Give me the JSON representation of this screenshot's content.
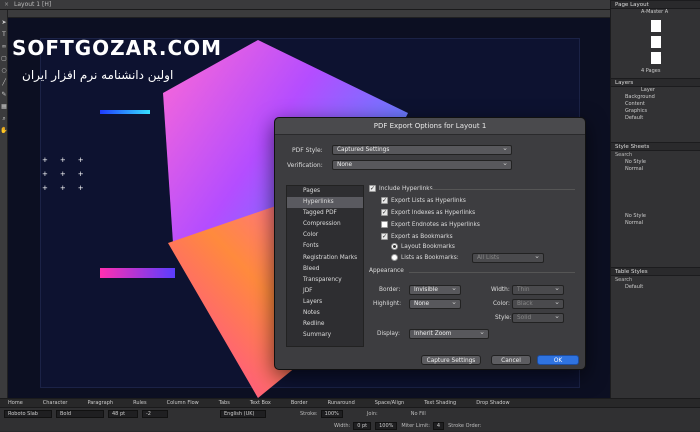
{
  "document": {
    "tab_title": "Layout 1 [H]"
  },
  "watermark": {
    "brand": "SOFTGOZAR.COM",
    "subtitle": "اولین دانشنامه نرم افزار ایران"
  },
  "right_panel": {
    "page_layout": {
      "title": "Page Layout",
      "master": "A-Master A",
      "pages_count": "4 Pages"
    },
    "layers": {
      "title": "Layers",
      "group": "Layer",
      "items": [
        "Background",
        "Content",
        "Graphics",
        "Default"
      ]
    },
    "style_sheets": {
      "title": "Style Sheets",
      "search": "Search",
      "items": [
        "No Style",
        "Normal"
      ],
      "items2": [
        "No Style",
        "Normal"
      ]
    },
    "table_styles": {
      "title": "Table Styles",
      "search": "Search",
      "item": "Default"
    }
  },
  "dialog": {
    "title": "PDF Export Options for Layout 1",
    "pdf_style_label": "PDF Style:",
    "pdf_style_value": "Captured Settings",
    "verification_label": "Verification:",
    "verification_value": "None",
    "categories": [
      "Pages",
      "Hyperlinks",
      "Tagged PDF",
      "Compression",
      "Color",
      "Fonts",
      "Registration Marks",
      "Bleed",
      "Transparency",
      "JDF",
      "Layers",
      "Notes",
      "Redline",
      "Summary"
    ],
    "active_category": "Hyperlinks",
    "include_hyperlinks": "Include Hyperlinks",
    "export_lists": "Export Lists as Hyperlinks",
    "export_indexes": "Export Indexes as Hyperlinks",
    "export_endnotes": "Export Endnotes as Hyperlinks",
    "export_bookmarks": "Export as Bookmarks",
    "layout_bookmarks": "Layout Bookmarks",
    "lists_as_bookmarks": "Lists as Bookmarks:",
    "lists_value": "All Lists",
    "appearance": "Appearance",
    "border_label": "Border:",
    "border_value": "Invisible",
    "highlight_label": "Highlight:",
    "highlight_value": "None",
    "width_label": "Width:",
    "width_value": "Thin",
    "color_label": "Color:",
    "color_value": "Black",
    "style_label": "Style:",
    "style_value": "Solid",
    "display_label": "Display:",
    "display_value": "Inherit Zoom",
    "capture_btn": "Capture Settings",
    "cancel_btn": "Cancel",
    "ok_btn": "OK"
  },
  "bottom_bar": {
    "tabs": [
      "Home",
      "Character",
      "Paragraph",
      "Rules",
      "Column Flow",
      "Tabs",
      "Text Box",
      "Border",
      "Runaround",
      "Space/Align",
      "Text Shading",
      "Drop Shadow"
    ],
    "font": "Roboto Slab",
    "weight": "Bold",
    "size": "48 pt",
    "tracking": "-2",
    "language": "English (UK)",
    "stroke_label": "Stroke:",
    "stroke_value": "100%",
    "width_label": "Width:",
    "width_value": "0 pt",
    "join_label": "Join:",
    "fill_label": "No Fill",
    "miter_label": "Miter Limit:",
    "miter_value": "4",
    "stroke_order": "Stroke Order:",
    "zoom": "100%"
  }
}
